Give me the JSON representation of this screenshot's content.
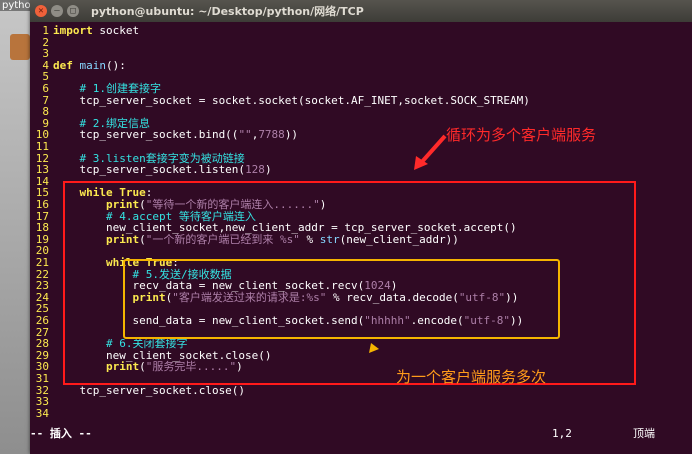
{
  "desktop": {
    "icon_label": "python"
  },
  "window": {
    "title": "python@ubuntu: ~/Desktop/python/网络/TCP"
  },
  "status": {
    "mode": "-- 插入 --",
    "position": "1,2",
    "scroll": "顶端"
  },
  "annotations": {
    "red_label": "循环为多个客户端服务",
    "yellow_label": "为一个客户端服务多次"
  },
  "colors": {
    "terminal_bg": "#300a24",
    "red_box": "#ff1a1a",
    "yellow_box": "#f5b400"
  },
  "code": [
    {
      "n": "1",
      "s": [
        [
          "kw",
          "import"
        ],
        [
          "t",
          " socket"
        ]
      ]
    },
    {
      "n": "2",
      "s": []
    },
    {
      "n": "3",
      "s": []
    },
    {
      "n": "4",
      "s": [
        [
          "kw",
          "def"
        ],
        [
          "t",
          " "
        ],
        [
          "fn",
          "main"
        ],
        [
          "t",
          "():"
        ]
      ]
    },
    {
      "n": "5",
      "s": []
    },
    {
      "n": "6",
      "s": [
        [
          "t",
          "    "
        ],
        [
          "cm",
          "# 1.创建套接字"
        ]
      ]
    },
    {
      "n": "7",
      "s": [
        [
          "t",
          "    tcp_server_socket = socket.socket(socket.AF_INET,socket.SOCK_STREAM)"
        ]
      ]
    },
    {
      "n": "8",
      "s": []
    },
    {
      "n": "9",
      "s": [
        [
          "t",
          "    "
        ],
        [
          "cm",
          "# 2.绑定信息"
        ]
      ]
    },
    {
      "n": "10",
      "s": [
        [
          "t",
          "    tcp_server_socket.bind(("
        ],
        [
          "str",
          "\"\""
        ],
        [
          "t",
          ","
        ],
        [
          "num",
          "7788"
        ],
        [
          "t",
          "))"
        ]
      ]
    },
    {
      "n": "11",
      "s": []
    },
    {
      "n": "12",
      "s": [
        [
          "t",
          "    "
        ],
        [
          "cm",
          "# 3.listen套接字变为被动链接"
        ]
      ]
    },
    {
      "n": "13",
      "s": [
        [
          "t",
          "    tcp_server_socket.listen("
        ],
        [
          "num",
          "128"
        ],
        [
          "t",
          ")"
        ]
      ]
    },
    {
      "n": "14",
      "s": []
    },
    {
      "n": "15",
      "s": [
        [
          "t",
          "    "
        ],
        [
          "kw",
          "while"
        ],
        [
          "t",
          " "
        ],
        [
          "kw",
          "True"
        ],
        [
          "t",
          ":"
        ]
      ]
    },
    {
      "n": "16",
      "s": [
        [
          "t",
          "        "
        ],
        [
          "kw",
          "print"
        ],
        [
          "t",
          "("
        ],
        [
          "str",
          "\"等待一个新的客户端连入......\""
        ],
        [
          "t",
          ")"
        ]
      ]
    },
    {
      "n": "17",
      "s": [
        [
          "t",
          "        "
        ],
        [
          "cm",
          "# 4.accept 等待客户端连入"
        ]
      ]
    },
    {
      "n": "18",
      "s": [
        [
          "t",
          "        new_client_socket,new_client_addr = tcp_server_socket.accept()"
        ]
      ]
    },
    {
      "n": "19",
      "s": [
        [
          "t",
          "        "
        ],
        [
          "kw",
          "print"
        ],
        [
          "t",
          "("
        ],
        [
          "str",
          "\"一个新的客户端已经到来 %s\""
        ],
        [
          "t",
          " % "
        ],
        [
          "fn",
          "str"
        ],
        [
          "t",
          "(new_client_addr))"
        ]
      ]
    },
    {
      "n": "20",
      "s": []
    },
    {
      "n": "21",
      "s": [
        [
          "t",
          "        "
        ],
        [
          "kw",
          "while"
        ],
        [
          "t",
          " "
        ],
        [
          "kw",
          "True"
        ],
        [
          "t",
          ":"
        ]
      ]
    },
    {
      "n": "22",
      "s": [
        [
          "t",
          "            "
        ],
        [
          "cm",
          "# 5.发送/接收数据"
        ]
      ]
    },
    {
      "n": "23",
      "s": [
        [
          "t",
          "            recv_data = new_client_socket.recv("
        ],
        [
          "num",
          "1024"
        ],
        [
          "t",
          ")"
        ]
      ]
    },
    {
      "n": "24",
      "s": [
        [
          "t",
          "            "
        ],
        [
          "kw",
          "print"
        ],
        [
          "t",
          "("
        ],
        [
          "str",
          "\"客户端发送过来的请求是:%s\""
        ],
        [
          "t",
          " % recv_data.decode("
        ],
        [
          "str",
          "\"utf-8\""
        ],
        [
          "t",
          "))"
        ]
      ]
    },
    {
      "n": "25",
      "s": []
    },
    {
      "n": "26",
      "s": [
        [
          "t",
          "            send_data = new_client_socket.send("
        ],
        [
          "str",
          "\"hhhhh\""
        ],
        [
          "t",
          ".encode("
        ],
        [
          "str",
          "\"utf-8\""
        ],
        [
          "t",
          "))"
        ]
      ]
    },
    {
      "n": "27",
      "s": []
    },
    {
      "n": "28",
      "s": [
        [
          "t",
          "        "
        ],
        [
          "cm",
          "# 6.关闭套接字"
        ]
      ]
    },
    {
      "n": "29",
      "s": [
        [
          "t",
          "        new_client_socket.close()"
        ]
      ]
    },
    {
      "n": "30",
      "s": [
        [
          "t",
          "        "
        ],
        [
          "kw",
          "print"
        ],
        [
          "t",
          "("
        ],
        [
          "str",
          "\"服务完毕.....\""
        ],
        [
          "t",
          ")"
        ]
      ]
    },
    {
      "n": "31",
      "s": []
    },
    {
      "n": "32",
      "s": [
        [
          "t",
          "    tcp_server_socket.close()"
        ]
      ]
    },
    {
      "n": "33",
      "s": []
    },
    {
      "n": "34",
      "s": []
    }
  ]
}
